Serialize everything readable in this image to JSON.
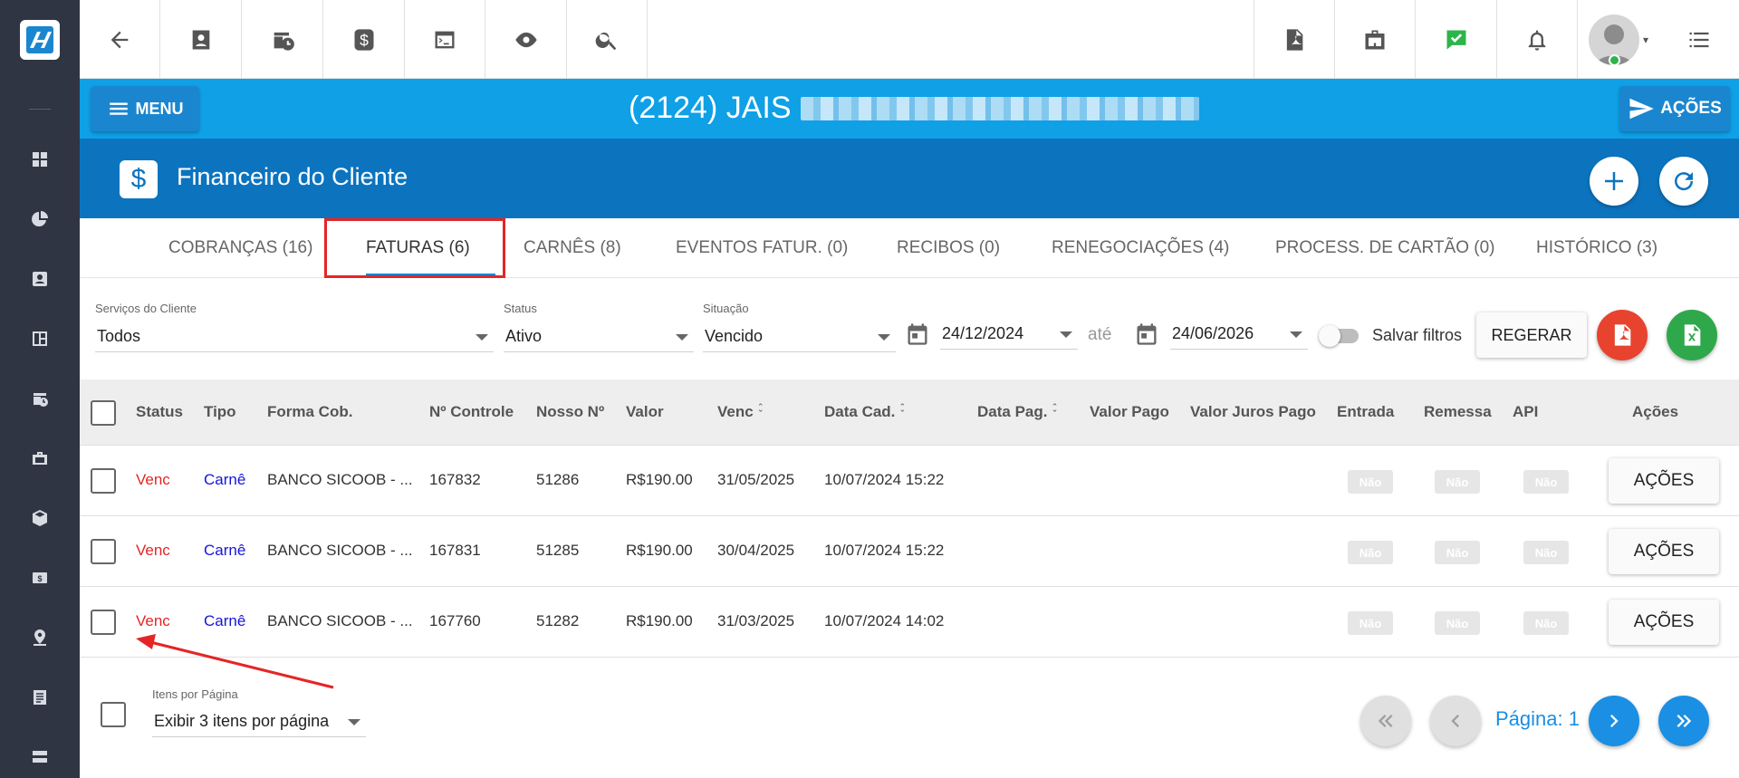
{
  "topbar": {
    "icons": [
      "back-arrow-icon",
      "contact-card-icon",
      "calendar-clock-icon",
      "dollar-icon",
      "terminal-icon",
      "eye-icon",
      "search-icon",
      "pdf-file-icon",
      "briefcase-icon",
      "chat-check-icon",
      "bell-icon",
      "avatar",
      "list-icon"
    ]
  },
  "client": {
    "menu_label": "MENU",
    "title": "(2124) JAIS",
    "acoes_label": "AÇÕES"
  },
  "section": {
    "icon": "$",
    "title": "Financeiro do Cliente"
  },
  "tabs": [
    {
      "label": "COBRANÇAS (16)"
    },
    {
      "label": "FATURAS (6)"
    },
    {
      "label": "CARNÊS (8)"
    },
    {
      "label": "EVENTOS FATUR. (0)"
    },
    {
      "label": "RECIBOS (0)"
    },
    {
      "label": "RENEGOCIAÇÕES (4)"
    },
    {
      "label": "PROCESS. DE CARTÃO (0)"
    },
    {
      "label": "HISTÓRICO (3)"
    }
  ],
  "filters": {
    "servicos_label": "Serviços do Cliente",
    "servicos_value": "Todos",
    "status_label": "Status",
    "status_value": "Ativo",
    "situacao_label": "Situação",
    "situacao_value": "Vencido",
    "date_from": "24/12/2024",
    "ate_label": "até",
    "date_to": "24/06/2026",
    "salvar_label": "Salvar filtros",
    "regerar_label": "REGERAR"
  },
  "table": {
    "headers": [
      "Status",
      "Tipo",
      "Forma Cob.",
      "Nº Controle",
      "Nosso Nº",
      "Valor",
      "Venc",
      "Data Cad.",
      "Data Pag.",
      "Valor Pago",
      "Valor Juros Pago",
      "Entrada",
      "Remessa",
      "API",
      "Ações"
    ],
    "rows": [
      {
        "status": "Venc",
        "tipo": "Carnê",
        "forma": "BANCO SICOOB - ...",
        "controle": "167832",
        "nosso": "51286",
        "valor": "R$190.00",
        "venc": "31/05/2025",
        "cad": "10/07/2024 15:22",
        "entrada": "Não",
        "remessa": "Não",
        "api": "Não",
        "acoes": "AÇÕES"
      },
      {
        "status": "Venc",
        "tipo": "Carnê",
        "forma": "BANCO SICOOB - ...",
        "controle": "167831",
        "nosso": "51285",
        "valor": "R$190.00",
        "venc": "30/04/2025",
        "cad": "10/07/2024 15:22",
        "entrada": "Não",
        "remessa": "Não",
        "api": "Não",
        "acoes": "AÇÕES"
      },
      {
        "status": "Venc",
        "tipo": "Carnê",
        "forma": "BANCO SICOOB - ...",
        "controle": "167760",
        "nosso": "51282",
        "valor": "R$190.00",
        "venc": "31/03/2025",
        "cad": "10/07/2024 14:02",
        "entrada": "Não",
        "remessa": "Não",
        "api": "Não",
        "acoes": "AÇÕES"
      }
    ]
  },
  "footer": {
    "per_page_label": "Itens por Página",
    "per_page_value": "Exibir 3 itens por página",
    "page_label": "Página: 1"
  },
  "colors": {
    "client_bar": "#0fa0e6",
    "section_bar": "#0c74bf",
    "rail": "#2f3542",
    "status_red": "#e52525",
    "tipo_blue": "#1616d6",
    "highlight": "#e52525"
  }
}
